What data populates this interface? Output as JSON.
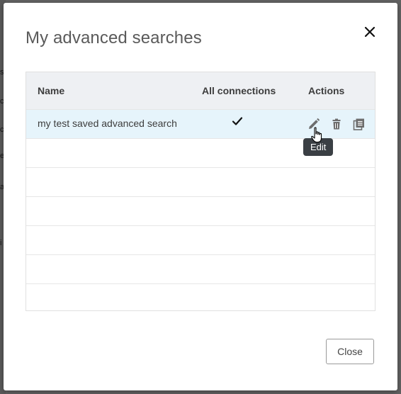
{
  "background": {
    "letters": [
      "s",
      "c",
      "c",
      "e",
      "a",
      "i"
    ]
  },
  "dialog": {
    "title": "My advanced searches",
    "close_icon": "close-icon"
  },
  "table": {
    "columns": [
      "Name",
      "All connections",
      "Actions"
    ],
    "rows": [
      {
        "name": "my test saved advanced search",
        "all_connections": true,
        "actions": [
          "pencil-icon",
          "trash-icon",
          "copy-icon"
        ]
      }
    ],
    "empty_rows": 6
  },
  "tooltip": {
    "text": "Edit"
  },
  "footer": {
    "close_label": "Close"
  },
  "colors": {
    "selected_row": "#e6f4fb",
    "header_bg": "#eef0f3",
    "tooltip_bg": "#3a3f44"
  }
}
